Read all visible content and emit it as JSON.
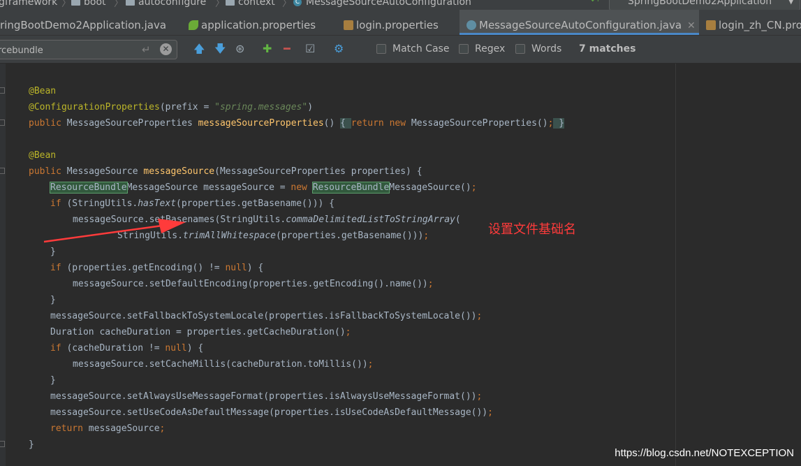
{
  "breadcrumb": {
    "items": [
      {
        "label": "gframework",
        "icon": "folder-icon"
      },
      {
        "label": "boot",
        "icon": "folder-icon"
      },
      {
        "label": "autoconfigure",
        "icon": "folder-icon"
      },
      {
        "label": "context",
        "icon": "folder-icon"
      },
      {
        "label": "MessageSourceAutoConfiguration",
        "icon": "class-icon"
      }
    ],
    "run_config": "SpringBootDemo2Application",
    "vcs_counts": "10\n01"
  },
  "tabs": [
    {
      "label": "ringBootDemo2Application.java",
      "icon": "java-class-icon",
      "active": false
    },
    {
      "label": "application.properties",
      "icon": "spring-icon",
      "active": false
    },
    {
      "label": "login.properties",
      "icon": "properties-file-icon",
      "active": false
    },
    {
      "label": "MessageSourceAutoConfiguration.java",
      "icon": "java-class-icon",
      "active": true
    },
    {
      "label": "login_zh_CN.pro",
      "icon": "properties-file-icon",
      "active": false
    }
  ],
  "find": {
    "query": "rcebundle",
    "options": [
      {
        "label": "Match Case",
        "checked": false
      },
      {
        "label": "Regex",
        "checked": false
      },
      {
        "label": "Words",
        "checked": false
      }
    ],
    "matches": "7 matches"
  },
  "code": {
    "lines": [
      "@Bean",
      "@ConfigurationProperties(prefix = \"spring.messages\")",
      "public MessageSourceProperties messageSourceProperties() { return new MessageSourceProperties(); }",
      "",
      "@Bean",
      "public MessageSource messageSource(MessageSourceProperties properties) {",
      "    ResourceBundleMessageSource messageSource = new ResourceBundleMessageSource();",
      "    if (StringUtils.hasText(properties.getBasename())) {",
      "        messageSource.setBasenames(StringUtils.commaDelimitedListToStringArray(",
      "                StringUtils.trimAllWhitespace(properties.getBasename())));",
      "    }",
      "    if (properties.getEncoding() != null) {",
      "        messageSource.setDefaultEncoding(properties.getEncoding().name());",
      "    }",
      "    messageSource.setFallbackToSystemLocale(properties.isFallbackToSystemLocale());",
      "    Duration cacheDuration = properties.getCacheDuration();",
      "    if (cacheDuration != null) {",
      "        messageSource.setCacheMillis(cacheDuration.toMillis());",
      "    }",
      "    messageSource.setAlwaysUseMessageFormat(properties.isAlwaysUseMessageFormat());",
      "    messageSource.setUseCodeAsDefaultMessage(properties.isUseCodeAsDefaultMessage());",
      "    return messageSource;",
      "}"
    ]
  },
  "annotation": "设置文件基础名",
  "watermark": "https://blog.csdn.net/NOTEXCEPTION",
  "colors": {
    "background": "#2b2b2b",
    "keyword": "#cc7832",
    "annotation": "#bbb529",
    "string": "#6a8759",
    "method_decl": "#ffc66d",
    "search_highlight": "#32593d",
    "arrow": "#ff3b3b"
  }
}
